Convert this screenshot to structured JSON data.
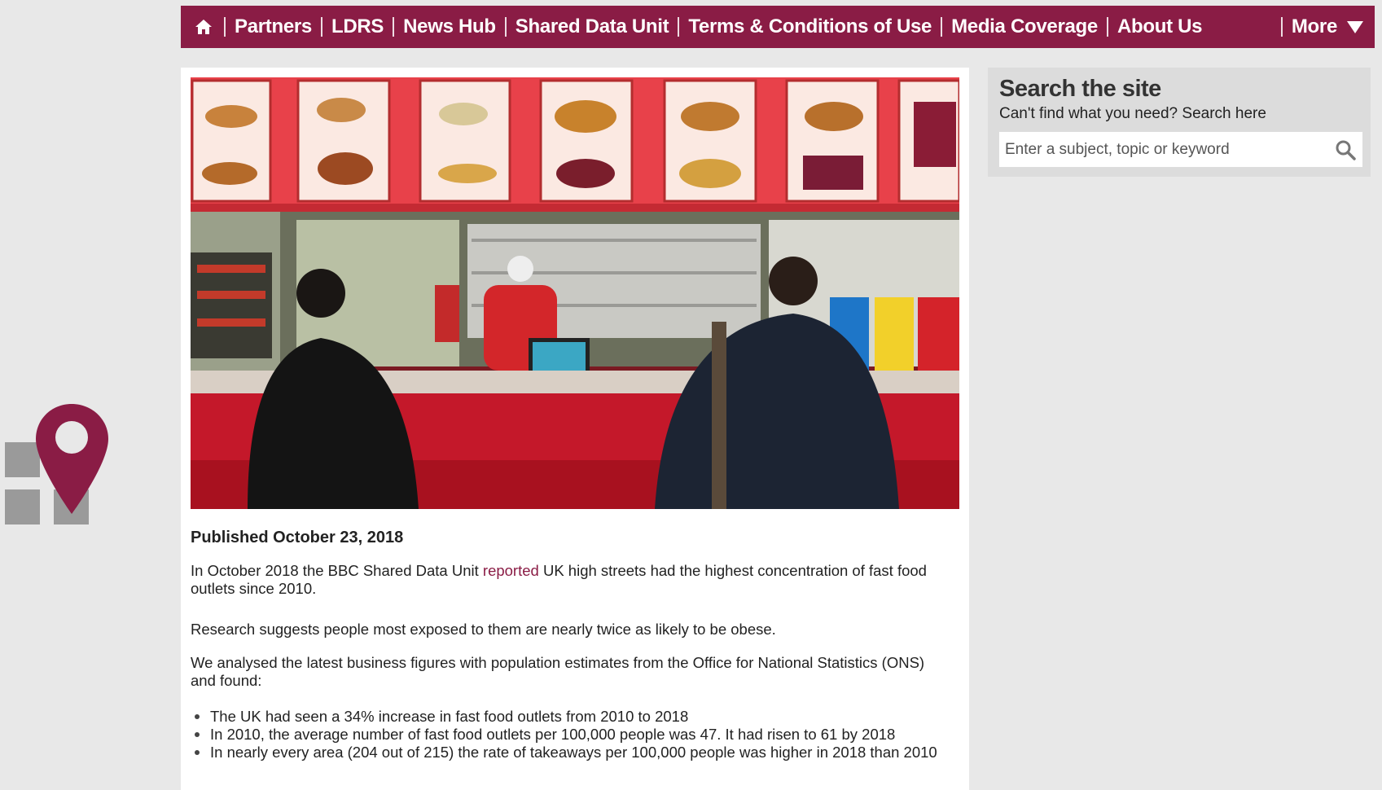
{
  "nav": {
    "items": [
      "Partners",
      "LDRS",
      "News Hub",
      "Shared Data Unit",
      "Terms & Conditions of Use",
      "Media Coverage",
      "About Us"
    ],
    "more_label": "More",
    "brand_color": "#8a1c45"
  },
  "hero": {
    "description_icon": "fast-food-counter-photo"
  },
  "article": {
    "published": "Published October 23, 2018",
    "p1_before": "In October 2018 the BBC Shared Data Unit ",
    "p1_link": "reported",
    "p1_after": " UK high streets had the highest concentration of fast food outlets since 2010.",
    "p2": "Research suggests people most exposed to them are nearly twice as likely to be obese.",
    "p3": "We analysed the latest business figures with population estimates from the Office for National Statistics (ONS) and found:",
    "bullets": [
      "The UK had seen a 34% increase in fast food outlets from 2010 to 2018",
      "In 2010, the average number of fast food outlets per 100,000 people was 47. It had risen to 61 by 2018",
      "In nearly every area (204 out of 215) the rate of takeaways per 100,000 people was higher in 2018 than 2010"
    ]
  },
  "search": {
    "title": "Search the site",
    "subtitle": "Can't find what you need? Search here",
    "placeholder": "Enter a subject, topic or keyword",
    "value": ""
  }
}
